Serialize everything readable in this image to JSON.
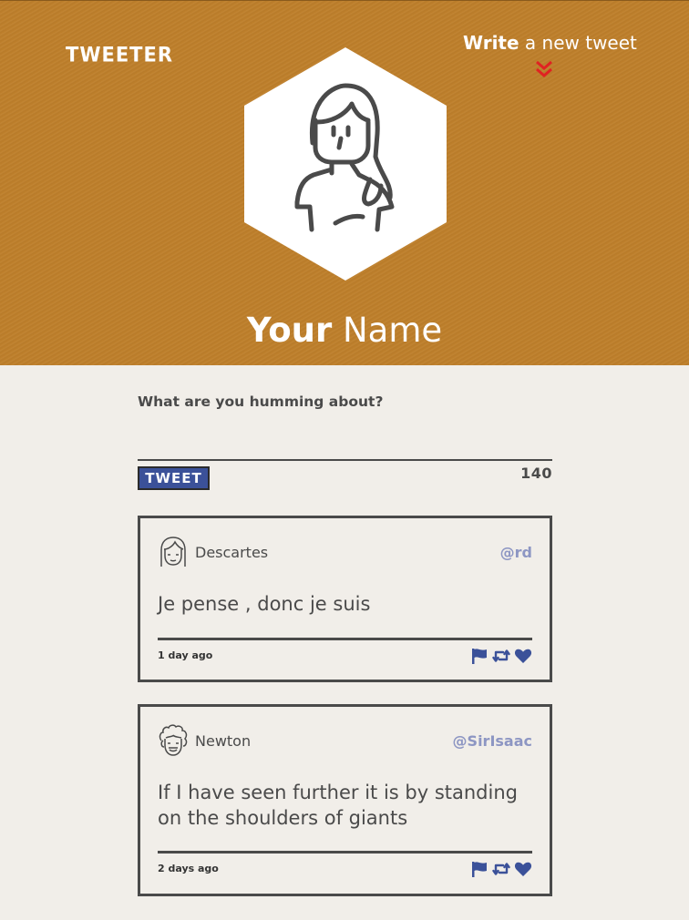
{
  "app": {
    "logo": "TWEETER"
  },
  "header": {
    "write_link": {
      "bold": "Write",
      "light": " a new tweet"
    },
    "profile_name": {
      "first": "Your",
      "last": " Name"
    }
  },
  "composer": {
    "label": "What are you humming about?",
    "input_value": "",
    "button_label": "TWEET",
    "counter": "140"
  },
  "tweets": [
    {
      "author": "Descartes",
      "handle": "@rd",
      "content": "Je pense , donc je suis",
      "time": "1 day ago",
      "avatar_icon": "girl-face-icon",
      "actions": [
        "flag-icon",
        "retweet-icon",
        "heart-icon"
      ]
    },
    {
      "author": "Newton",
      "handle": "@SirIsaac",
      "content": "If I have seen further it is by standing on the shoulders of giants",
      "time": "2 days ago",
      "avatar_icon": "curly-hair-face-icon",
      "actions": [
        "flag-icon",
        "retweet-icon",
        "heart-icon"
      ]
    }
  ],
  "colors": {
    "header_bg": "#be7f2b",
    "page_bg": "#f1eee9",
    "text": "#4a4a4a",
    "accent_blue": "#3b5199",
    "handle": "#8d96c3",
    "chevron": "#e02222"
  }
}
